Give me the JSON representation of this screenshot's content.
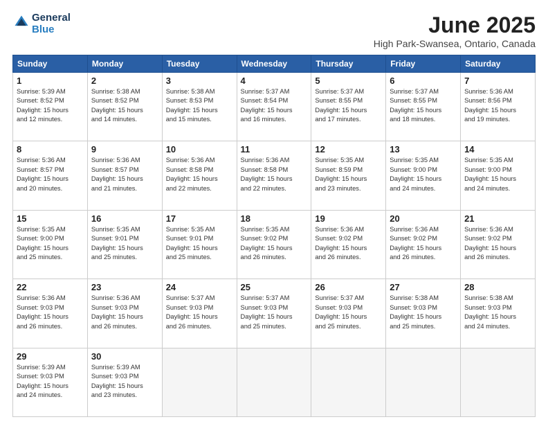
{
  "header": {
    "logo_line1": "General",
    "logo_line2": "Blue",
    "month": "June 2025",
    "location": "High Park-Swansea, Ontario, Canada"
  },
  "days_of_week": [
    "Sunday",
    "Monday",
    "Tuesday",
    "Wednesday",
    "Thursday",
    "Friday",
    "Saturday"
  ],
  "weeks": [
    [
      {
        "day": "1",
        "info": "Sunrise: 5:39 AM\nSunset: 8:52 PM\nDaylight: 15 hours\nand 12 minutes."
      },
      {
        "day": "2",
        "info": "Sunrise: 5:38 AM\nSunset: 8:52 PM\nDaylight: 15 hours\nand 14 minutes."
      },
      {
        "day": "3",
        "info": "Sunrise: 5:38 AM\nSunset: 8:53 PM\nDaylight: 15 hours\nand 15 minutes."
      },
      {
        "day": "4",
        "info": "Sunrise: 5:37 AM\nSunset: 8:54 PM\nDaylight: 15 hours\nand 16 minutes."
      },
      {
        "day": "5",
        "info": "Sunrise: 5:37 AM\nSunset: 8:55 PM\nDaylight: 15 hours\nand 17 minutes."
      },
      {
        "day": "6",
        "info": "Sunrise: 5:37 AM\nSunset: 8:55 PM\nDaylight: 15 hours\nand 18 minutes."
      },
      {
        "day": "7",
        "info": "Sunrise: 5:36 AM\nSunset: 8:56 PM\nDaylight: 15 hours\nand 19 minutes."
      }
    ],
    [
      {
        "day": "8",
        "info": "Sunrise: 5:36 AM\nSunset: 8:57 PM\nDaylight: 15 hours\nand 20 minutes."
      },
      {
        "day": "9",
        "info": "Sunrise: 5:36 AM\nSunset: 8:57 PM\nDaylight: 15 hours\nand 21 minutes."
      },
      {
        "day": "10",
        "info": "Sunrise: 5:36 AM\nSunset: 8:58 PM\nDaylight: 15 hours\nand 22 minutes."
      },
      {
        "day": "11",
        "info": "Sunrise: 5:36 AM\nSunset: 8:58 PM\nDaylight: 15 hours\nand 22 minutes."
      },
      {
        "day": "12",
        "info": "Sunrise: 5:35 AM\nSunset: 8:59 PM\nDaylight: 15 hours\nand 23 minutes."
      },
      {
        "day": "13",
        "info": "Sunrise: 5:35 AM\nSunset: 9:00 PM\nDaylight: 15 hours\nand 24 minutes."
      },
      {
        "day": "14",
        "info": "Sunrise: 5:35 AM\nSunset: 9:00 PM\nDaylight: 15 hours\nand 24 minutes."
      }
    ],
    [
      {
        "day": "15",
        "info": "Sunrise: 5:35 AM\nSunset: 9:00 PM\nDaylight: 15 hours\nand 25 minutes."
      },
      {
        "day": "16",
        "info": "Sunrise: 5:35 AM\nSunset: 9:01 PM\nDaylight: 15 hours\nand 25 minutes."
      },
      {
        "day": "17",
        "info": "Sunrise: 5:35 AM\nSunset: 9:01 PM\nDaylight: 15 hours\nand 25 minutes."
      },
      {
        "day": "18",
        "info": "Sunrise: 5:35 AM\nSunset: 9:02 PM\nDaylight: 15 hours\nand 26 minutes."
      },
      {
        "day": "19",
        "info": "Sunrise: 5:36 AM\nSunset: 9:02 PM\nDaylight: 15 hours\nand 26 minutes."
      },
      {
        "day": "20",
        "info": "Sunrise: 5:36 AM\nSunset: 9:02 PM\nDaylight: 15 hours\nand 26 minutes."
      },
      {
        "day": "21",
        "info": "Sunrise: 5:36 AM\nSunset: 9:02 PM\nDaylight: 15 hours\nand 26 minutes."
      }
    ],
    [
      {
        "day": "22",
        "info": "Sunrise: 5:36 AM\nSunset: 9:03 PM\nDaylight: 15 hours\nand 26 minutes."
      },
      {
        "day": "23",
        "info": "Sunrise: 5:36 AM\nSunset: 9:03 PM\nDaylight: 15 hours\nand 26 minutes."
      },
      {
        "day": "24",
        "info": "Sunrise: 5:37 AM\nSunset: 9:03 PM\nDaylight: 15 hours\nand 26 minutes."
      },
      {
        "day": "25",
        "info": "Sunrise: 5:37 AM\nSunset: 9:03 PM\nDaylight: 15 hours\nand 25 minutes."
      },
      {
        "day": "26",
        "info": "Sunrise: 5:37 AM\nSunset: 9:03 PM\nDaylight: 15 hours\nand 25 minutes."
      },
      {
        "day": "27",
        "info": "Sunrise: 5:38 AM\nSunset: 9:03 PM\nDaylight: 15 hours\nand 25 minutes."
      },
      {
        "day": "28",
        "info": "Sunrise: 5:38 AM\nSunset: 9:03 PM\nDaylight: 15 hours\nand 24 minutes."
      }
    ],
    [
      {
        "day": "29",
        "info": "Sunrise: 5:39 AM\nSunset: 9:03 PM\nDaylight: 15 hours\nand 24 minutes."
      },
      {
        "day": "30",
        "info": "Sunrise: 5:39 AM\nSunset: 9:03 PM\nDaylight: 15 hours\nand 23 minutes."
      },
      {
        "day": "",
        "info": ""
      },
      {
        "day": "",
        "info": ""
      },
      {
        "day": "",
        "info": ""
      },
      {
        "day": "",
        "info": ""
      },
      {
        "day": "",
        "info": ""
      }
    ]
  ]
}
